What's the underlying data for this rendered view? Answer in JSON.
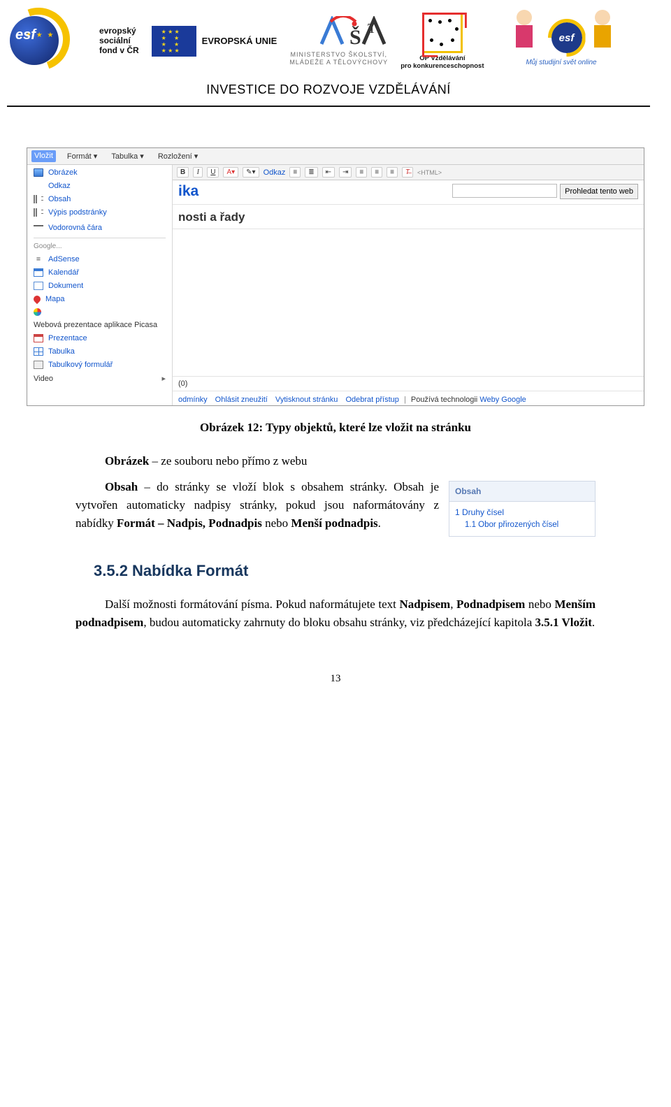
{
  "header": {
    "esf_label": "esf",
    "cs_text_lines": [
      "evropský",
      "sociální",
      "fond v ČR"
    ],
    "eu_label": "EVROPSKÁ UNIE",
    "msmt_lines": [
      "MINISTERSTVO ŠKOLSTVÍ,",
      "MLÁDEŽE A TĚLOVÝCHOVY"
    ],
    "opvk_lines": [
      "OP Vzdělávání",
      "pro konkurenceschopnost"
    ],
    "right_arc": "Můj studijní svět online",
    "right_badge": "esf",
    "invest_line": "INVESTICE DO ROZVOJE VZDĚLÁVÁNÍ"
  },
  "screenshot": {
    "menubar": [
      "Vložit",
      "Formát ▾",
      "Tabulka ▾",
      "Rozložení ▾"
    ],
    "dropdown_items_top": [
      "Obrázek",
      "Odkaz",
      "Obsah",
      "Výpis podstránky",
      "Vodorovná čára"
    ],
    "dropdown_label_google": "Google...",
    "dropdown_items_google": [
      "AdSense",
      "Kalendář",
      "Dokument",
      "Mapa",
      "",
      "Webová prezentace aplikace Picasa",
      "Prezentace",
      "Tabulka",
      "Tabulkový formulář",
      "Video"
    ],
    "toolbar": {
      "link_label": "Odkaz",
      "html_label": "HTML"
    },
    "page_title": "ika",
    "subtitle": "nosti a řady",
    "search_btn": "Prohledat tento web",
    "attachments": "(0)",
    "footer_links": [
      "odmínky",
      "Ohlásit zneužití",
      "Vytisknout stránku",
      "Odebrat přístup"
    ],
    "footer_tech_prefix": "Používá technologii ",
    "footer_tech_link": "Weby Google"
  },
  "caption": "Obrázek 12: Typy objektů, které lze vložit na stránku",
  "para1_plain": "Obrázek",
  "para1_rest": " – ze souboru nebo přímo z webu",
  "para2_lead": "Obsah",
  "para2_mid1": " – do stránky se vloží blok s obsahem stránky. Obsah je vytvořen automaticky nadpisy stránky, pokud jsou naformátovány z nabídky ",
  "para2_bold2": "Formát – Nadpis, Podnadpis",
  "para2_mid2": " nebo ",
  "para2_bold3": "Menší podnadpis",
  "para2_end": ".",
  "heading2": "3.5.2  Nabídka Formát",
  "para3_a": "Další možnosti formátování písma. Pokud naformátujete text ",
  "para3_b1": "Nadpisem",
  "para3_c": ", ",
  "para3_b2": "Podnadpisem",
  "para3_d": " nebo ",
  "para3_b3": "Menším podnadpisem",
  "para3_e": ", budou automaticky zahrnuty do bloku obsahu stránky, viz předcházející kapitola ",
  "para3_b4": "3.5.1 Vložit",
  "para3_f": ".",
  "floatbox": {
    "title": "Obsah",
    "l1": "1 Druhy čísel",
    "l2": "1.1 Obor přirozených čísel"
  },
  "page_number": "13"
}
